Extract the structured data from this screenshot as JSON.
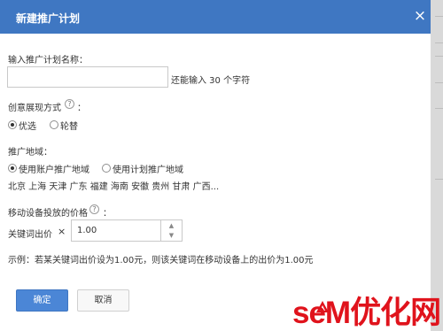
{
  "dialog": {
    "title": "新建推广计划",
    "close_icon": "×"
  },
  "plan_name": {
    "label": "输入推广计划名称：",
    "value": "",
    "remaining_text": "还能输入 30 个字符"
  },
  "creative_mode": {
    "label": "创意展现方式",
    "help_icon": "?",
    "colon": "：",
    "options": [
      {
        "label": "优选",
        "selected": true
      },
      {
        "label": "轮替",
        "selected": false
      }
    ]
  },
  "region": {
    "label": "推广地域：",
    "options": [
      {
        "label": "使用账户推广地域",
        "selected": true
      },
      {
        "label": "使用计划推广地域",
        "selected": false
      }
    ],
    "summary": "北京 上海 天津 广东 福建 海南 安徽 贵州 甘肃 广西..."
  },
  "mobile_price": {
    "label": "移动设备投放的价格",
    "help_icon": "?",
    "colon": "：",
    "bid_label": "关键词出价",
    "multiplier_icon": "×",
    "value": "1.00",
    "up_icon": "▲",
    "down_icon": "▼",
    "example": "示例：若某关键词出价设为1.00元，则该关键词在移动设备上的出价为1.00元"
  },
  "buttons": {
    "confirm": "确定",
    "cancel": "取消"
  },
  "watermark": {
    "text": "seM优化网"
  },
  "colors": {
    "titlebar": "#3f77c2",
    "primary_button": "#4b86d6",
    "watermark": "#e0131c"
  }
}
